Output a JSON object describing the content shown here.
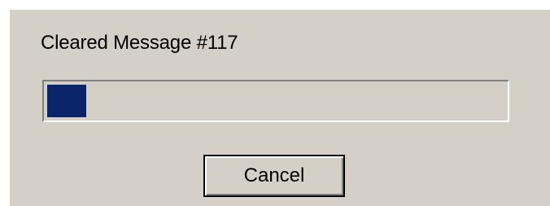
{
  "dialog": {
    "message": "Cleared Message #117",
    "progress": {
      "fraction": 0.085,
      "fill_color": "#0a246a",
      "track_color": "#d4d0c8"
    },
    "cancel_label": "Cancel"
  },
  "colors": {
    "dialog_background": "#d4d0c8",
    "page_background": "#ffffff"
  }
}
